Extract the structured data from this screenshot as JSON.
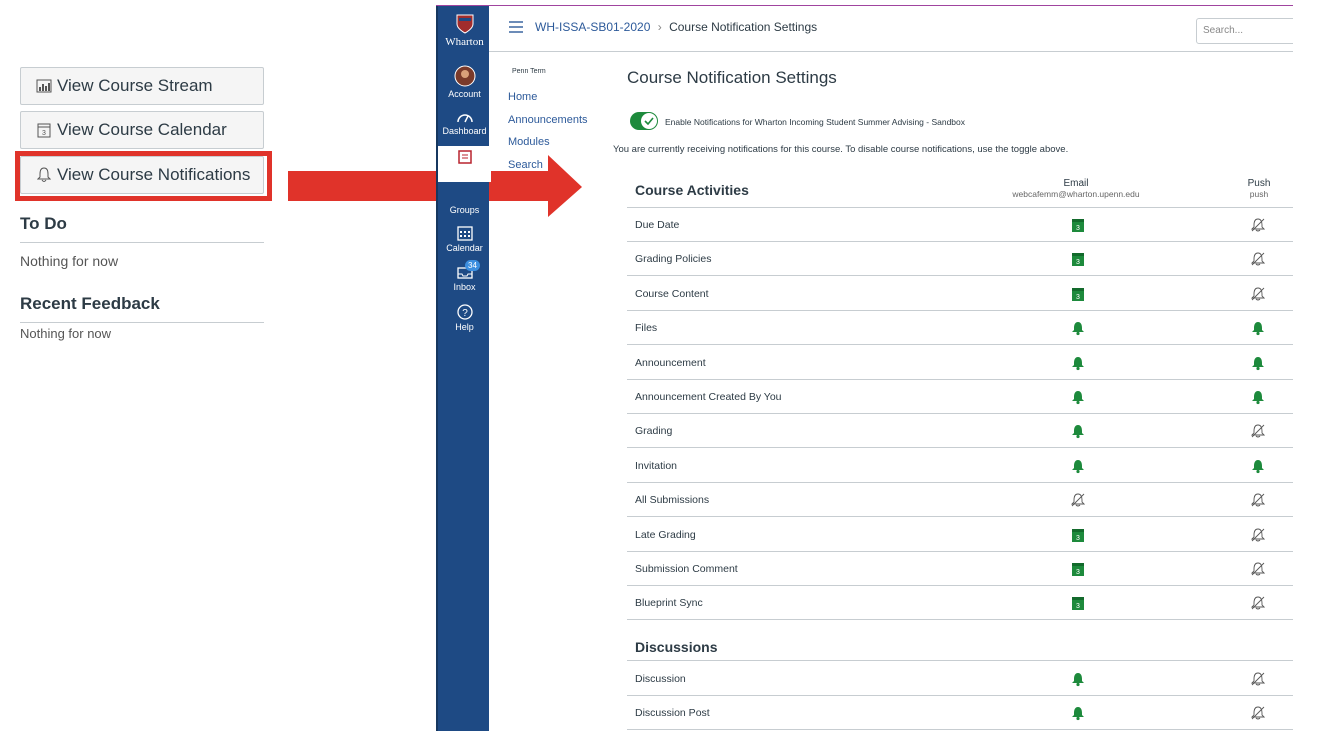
{
  "left_panel": {
    "buttons": [
      "View Course Stream",
      "View Course Calendar",
      "View Course Notifications"
    ],
    "todo_heading": "To Do",
    "todo_text": "Nothing for now",
    "feedback_heading": "Recent Feedback",
    "feedback_text": "Nothing for now"
  },
  "global_nav": {
    "logo": "Wharton",
    "items": [
      "Account",
      "Dashboard",
      "Courses",
      "Groups",
      "Calendar",
      "Inbox",
      "Help"
    ],
    "inbox_badge": "34"
  },
  "header": {
    "course_code": "WH-ISSA-SB01-2020",
    "separator": "›",
    "page": "Course Notification Settings",
    "search_placeholder": "Search..."
  },
  "course_nav": {
    "term": "Penn Term",
    "items": [
      "Home",
      "Announcements",
      "Modules",
      "Search"
    ]
  },
  "main": {
    "title": "Course Notification Settings",
    "toggle_label": "Enable Notifications for Wharton Incoming Student Summer Advising - Sandbox",
    "toggle_on": true,
    "info_text": "You are currently receiving notifications for this course. To disable course notifications, use the toggle above.",
    "email_header": "Email",
    "email_sub": "webcafemm@wharton.upenn.edu",
    "push_header": "Push",
    "push_sub": "push",
    "sections": [
      {
        "title": "Course Activities",
        "rows": [
          {
            "name": "Due Date",
            "email": "daily",
            "push": "off"
          },
          {
            "name": "Grading Policies",
            "email": "daily",
            "push": "off"
          },
          {
            "name": "Course Content",
            "email": "daily",
            "push": "off"
          },
          {
            "name": "Files",
            "email": "on",
            "push": "on"
          },
          {
            "name": "Announcement",
            "email": "on",
            "push": "on"
          },
          {
            "name": "Announcement Created By You",
            "email": "on",
            "push": "on"
          },
          {
            "name": "Grading",
            "email": "on",
            "push": "off"
          },
          {
            "name": "Invitation",
            "email": "on",
            "push": "on"
          },
          {
            "name": "All Submissions",
            "email": "off",
            "push": "off"
          },
          {
            "name": "Late Grading",
            "email": "daily",
            "push": "off"
          },
          {
            "name": "Submission Comment",
            "email": "daily",
            "push": "off"
          },
          {
            "name": "Blueprint Sync",
            "email": "daily",
            "push": "off"
          }
        ]
      },
      {
        "title": "Discussions",
        "rows": [
          {
            "name": "Discussion",
            "email": "on",
            "push": "off"
          },
          {
            "name": "Discussion Post",
            "email": "on",
            "push": "off"
          }
        ]
      }
    ]
  },
  "colors": {
    "green": "#1d8a3c",
    "nav_blue": "#1e4a84",
    "highlight_red": "#e0332a"
  }
}
